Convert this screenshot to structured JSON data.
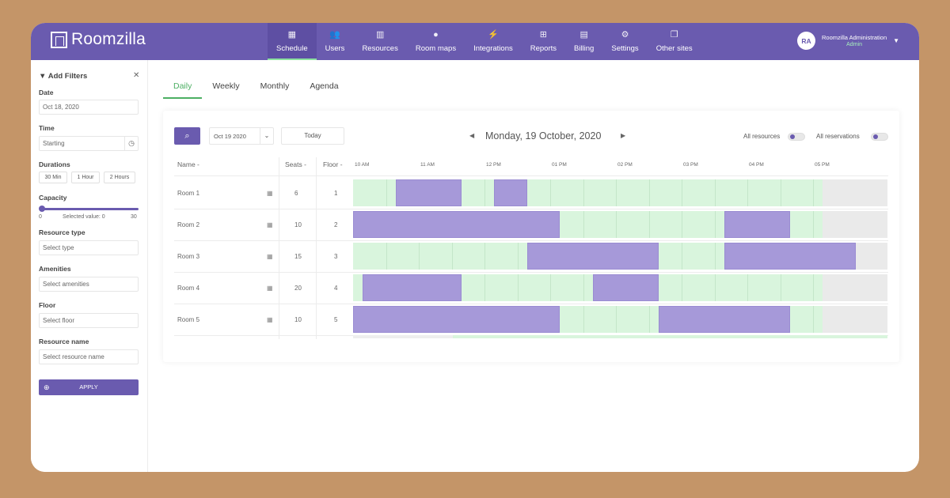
{
  "app": {
    "name": "Roomzilla"
  },
  "nav": [
    {
      "label": "Schedule",
      "icon": "building-icon",
      "glyph": "▦",
      "active": true
    },
    {
      "label": "Users",
      "icon": "users-icon",
      "glyph": "👥",
      "active": false
    },
    {
      "label": "Resources",
      "icon": "building-icon",
      "glyph": "▥",
      "active": false
    },
    {
      "label": "Room maps",
      "icon": "map-pin-icon",
      "glyph": "●",
      "active": false
    },
    {
      "label": "Integrations",
      "icon": "plug-icon",
      "glyph": "⚡",
      "active": false
    },
    {
      "label": "Reports",
      "icon": "table-icon",
      "glyph": "⊞",
      "active": false
    },
    {
      "label": "Billing",
      "icon": "invoice-icon",
      "glyph": "▤",
      "active": false
    },
    {
      "label": "Settings",
      "icon": "gears-icon",
      "glyph": "⚙",
      "active": false
    },
    {
      "label": "Other sites",
      "icon": "copy-icon",
      "glyph": "❐",
      "active": false
    }
  ],
  "user": {
    "initials": "RA",
    "name": "Roomzilla Administration",
    "role": "Admin"
  },
  "filters": {
    "title": "Add Filters",
    "date_label": "Date",
    "date_value": "Oct 18, 2020",
    "time_label": "Time",
    "time_value": "Starting",
    "durations_label": "Durations",
    "durations": [
      "30 Min",
      "1 Hour",
      "2 Hours"
    ],
    "capacity_label": "Capacity",
    "capacity_min": "0",
    "capacity_max": "30",
    "capacity_selected": "Selected value: 0",
    "resource_type_label": "Resource type",
    "resource_type_placeholder": "Select type",
    "amenities_label": "Amenities",
    "amenities_placeholder": "Select amenities",
    "floor_label": "Floor",
    "floor_placeholder": "Select floor",
    "resource_name_label": "Resource name",
    "resource_name_placeholder": "Select resource name",
    "apply_label": "APPLY"
  },
  "view_tabs": [
    {
      "label": "Daily",
      "active": true
    },
    {
      "label": "Weekly",
      "active": false
    },
    {
      "label": "Monthly",
      "active": false
    },
    {
      "label": "Agenda",
      "active": false
    }
  ],
  "toolbar": {
    "date_select": "Oct 19 2020",
    "today_label": "Today",
    "current_date": "Monday, 19 October, 2020",
    "all_resources_label": "All resources",
    "all_reservations_label": "All reservations"
  },
  "table": {
    "columns": {
      "name": "Name",
      "seats": "Seats",
      "floor": "Floor"
    },
    "time_ticks": [
      "10 AM",
      "11 AM",
      "12 PM",
      "01 PM",
      "02 PM",
      "03 PM",
      "04 PM",
      "05 PM"
    ],
    "rooms": [
      {
        "name": "Room 1",
        "seats": "6",
        "floor": "1",
        "bookings": [
          [
            10.65,
            11.65
          ],
          [
            12.15,
            12.65
          ]
        ]
      },
      {
        "name": "Room 2",
        "seats": "10",
        "floor": "2",
        "bookings": [
          [
            10.0,
            13.15
          ],
          [
            15.65,
            16.65
          ]
        ]
      },
      {
        "name": "Room 3",
        "seats": "15",
        "floor": "3",
        "bookings": [
          [
            12.65,
            14.65
          ],
          [
            15.65,
            17.65
          ]
        ]
      },
      {
        "name": "Room 4",
        "seats": "20",
        "floor": "4",
        "bookings": [
          [
            10.15,
            11.65
          ],
          [
            13.65,
            14.65
          ]
        ]
      },
      {
        "name": "Room 5",
        "seats": "10",
        "floor": "5",
        "bookings": [
          [
            10.0,
            13.15
          ],
          [
            14.65,
            16.65
          ]
        ]
      }
    ],
    "timeline_start": 10.0,
    "timeline_end": 18.1,
    "past_from": 17.15
  },
  "colors": {
    "primary": "#6A5BAF",
    "booking": "#A699D9",
    "available": "#D9F5DD",
    "accent": "#4CAF63"
  }
}
